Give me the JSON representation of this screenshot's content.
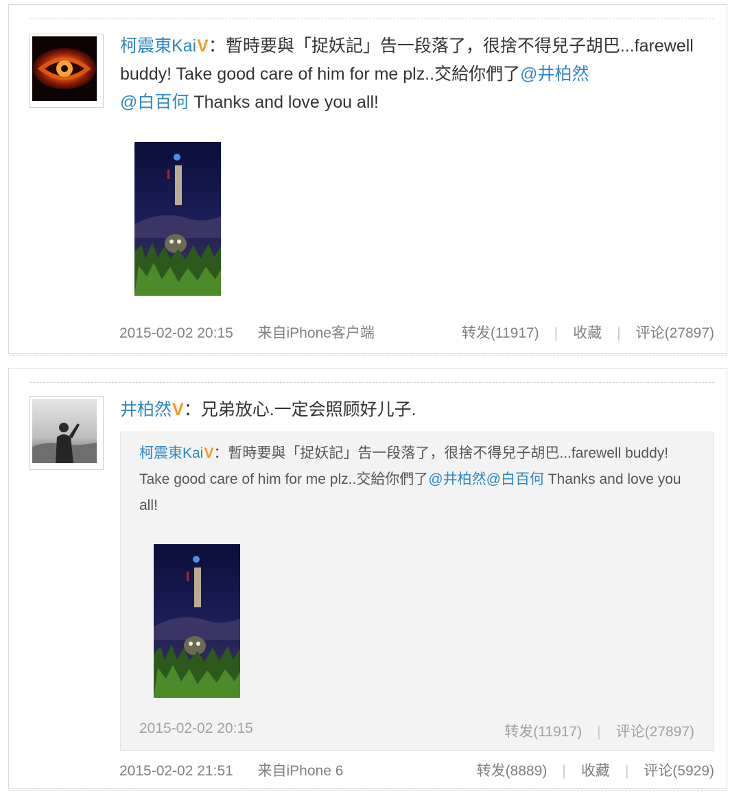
{
  "post1": {
    "username": "柯震東Kai",
    "badge": "V",
    "colon": "：",
    "text_a": "暫時要與「捉妖記」告一段落了，很捨不得兒子胡巴...farewell buddy! Take good care of him for me plz..交給你們了",
    "mention1": "@井柏然",
    "mention2": "@白百何",
    "text_b": " Thanks and love you all!",
    "time": "2015-02-02 20:15",
    "source": "来自iPhone客户端",
    "repost": "转发(11917)",
    "favorite": "收藏",
    "comment": "评论(27897)",
    "divider": "|"
  },
  "post2": {
    "username": "井柏然",
    "badge": "V",
    "colon": "：",
    "text": "兄弟放心.一定会照顾好儿子.",
    "time": "2015-02-02 21:51",
    "source": "来自iPhone 6",
    "repost": "转发(8889)",
    "favorite": "收藏",
    "comment": "评论(5929)",
    "divider": "|",
    "quoted": {
      "username": "柯震東Kai",
      "badge": "V",
      "colon": "：",
      "text_a": "暫時要與「捉妖記」告一段落了，很捨不得兒子胡巴...farewell buddy! Take good care of him for me plz..交給你們了",
      "mention1": "@井柏然",
      "mention2": "@白百何",
      "text_b": " Thanks and love you all!",
      "time": "2015-02-02 20:15",
      "repost": "转发(11917)",
      "comment": "评论(27897)",
      "divider": "|"
    }
  },
  "colors": {
    "link": "#2e86c7",
    "verified_badge": "#f59a23",
    "meta_text": "#808080"
  }
}
